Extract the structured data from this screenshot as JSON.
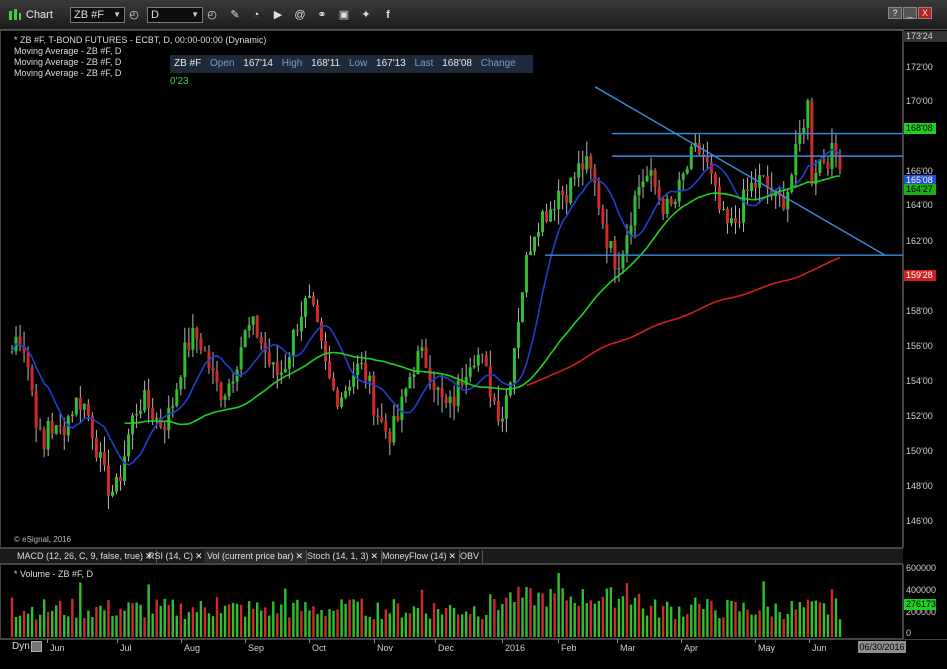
{
  "window": {
    "title": "Chart",
    "symbol_select": "ZB #F",
    "interval_select": "D",
    "win_buttons": [
      "?",
      "_",
      "□",
      "X"
    ]
  },
  "toolbar": {
    "icons": [
      "clock-icon",
      "pencil-icon",
      "cursor-icon",
      "play-icon",
      "at-icon",
      "link-icon",
      "chat-icon",
      "twitter-icon",
      "facebook-icon"
    ]
  },
  "legend": {
    "line1": "* ZB #F, T-BOND FUTURES - ECBT, D, 00:00-00:00 (Dynamic)",
    "line2": "Moving Average - ZB #F, D",
    "line3": "Moving Average - ZB #F, D",
    "line4": "Moving Average - ZB #F, D"
  },
  "quote": {
    "symbol": "ZB #F",
    "open_label": "Open",
    "open": "167'14",
    "high_label": "High",
    "high": "168'11",
    "low_label": "Low",
    "low": "167'13",
    "last_label": "Last",
    "last": "168'08",
    "change_label": "Change",
    "change": "0'23"
  },
  "watermark": "© eSignal, 2016",
  "price_axis": {
    "top_value": "173'24",
    "labels": [
      "172'00",
      "170'00",
      "166'00",
      "164'00",
      "162'00",
      "158'00",
      "156'00",
      "154'00",
      "152'00",
      "150'00",
      "148'00",
      "146'00"
    ],
    "badges": [
      {
        "text": "168'08",
        "color": "#1fd11f",
        "text_color": "#000"
      },
      {
        "text": "165'08",
        "color": "#1f4fd1",
        "text_color": "#fff"
      },
      {
        "text": "164'27",
        "color": "#19b019",
        "text_color": "#000"
      },
      {
        "text": "159'28",
        "color": "#d11f1f",
        "text_color": "#fff"
      }
    ]
  },
  "tabs": [
    {
      "label": "MACD (12, 26, C, 9, false, true)"
    },
    {
      "label": "RSI (14, C)"
    },
    {
      "label": "Vol (current price bar)"
    },
    {
      "label": "Stoch (14, 1, 3)"
    },
    {
      "label": "MoneyFlow (14)"
    },
    {
      "label": "OBV"
    }
  ],
  "volume": {
    "title": "* Volume - ZB #F, D",
    "axis_labels": [
      "600000",
      "400000",
      "200000",
      "0"
    ],
    "badge": "276173"
  },
  "time_axis": {
    "dyn": "Dyn",
    "labels": [
      "Jun",
      "Jul",
      "Aug",
      "Sep",
      "Oct",
      "Nov",
      "Dec",
      "2016",
      "Feb",
      "Mar",
      "Apr",
      "May",
      "Jun"
    ],
    "date": "06/30/2016"
  },
  "chart_data": {
    "type": "candlestick",
    "symbol": "ZB #F",
    "interval": "D",
    "y_range": [
      145,
      173.75
    ],
    "x_labels": [
      "Jun",
      "Jul",
      "Aug",
      "Sep",
      "Oct",
      "Nov",
      "Dec",
      "2016",
      "Feb",
      "Mar",
      "Apr",
      "May",
      "Jun"
    ],
    "close_by_month": [
      {
        "month": "Jun",
        "close": 153.5
      },
      {
        "month": "Jul",
        "close": 149.5
      },
      {
        "month": "Aug",
        "close": 155.0
      },
      {
        "month": "Sep",
        "close": 155.5
      },
      {
        "month": "Oct",
        "close": 157.0
      },
      {
        "month": "Nov",
        "close": 152.5
      },
      {
        "month": "Dec",
        "close": 154.5
      },
      {
        "month": "2016",
        "close": 154.0
      },
      {
        "month": "Feb",
        "close": 166.5
      },
      {
        "month": "Mar",
        "close": 162.5
      },
      {
        "month": "Apr",
        "close": 166.0
      },
      {
        "month": "May",
        "close": 163.5
      },
      {
        "month": "Jun",
        "close": 168.25
      }
    ],
    "last": 168.25,
    "moving_averages": [
      {
        "color": "#1f3fd1",
        "last": 165.25
      },
      {
        "color": "#1fd11f",
        "last": 164.84
      },
      {
        "color": "#d11f1f",
        "last": 159.875
      }
    ],
    "horizontal_lines": [
      168.0,
      166.75,
      161.25
    ],
    "volume_range": [
      0,
      700000
    ]
  }
}
